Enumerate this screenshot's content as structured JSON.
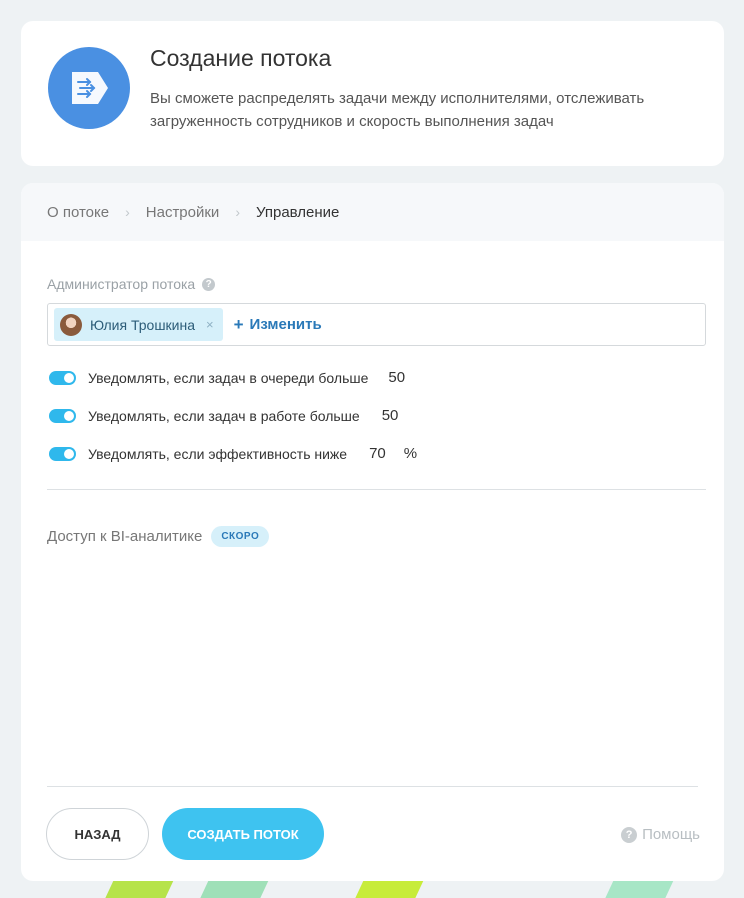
{
  "header": {
    "title": "Создание потока",
    "description": "Вы сможете распределять задачи между исполнителями, отслеживать загруженность сотрудников и скорость выполнения задач",
    "icon": "flow-icon"
  },
  "steps": [
    {
      "label": "О потоке"
    },
    {
      "label": "Настройки"
    },
    {
      "label": "Управление",
      "active": true
    }
  ],
  "admin": {
    "label": "Администратор потока",
    "user_name": "Юлия Трошкина",
    "remove_glyph": "×",
    "change_label": "Изменить",
    "change_plus": "+"
  },
  "notifications": [
    {
      "label": "Уведомлять, если задач в очереди больше",
      "value": "50",
      "unit": "",
      "enabled": true
    },
    {
      "label": "Уведомлять, если задач в работе больше",
      "value": "50",
      "unit": "",
      "enabled": true
    },
    {
      "label": "Уведомлять, если эффективность ниже",
      "value": "70",
      "unit": "%",
      "enabled": true
    }
  ],
  "bi": {
    "label": "Доступ к BI-аналитике",
    "badge": "СКОРО"
  },
  "footer": {
    "back_label": "НАЗАД",
    "create_label": "СОЗДАТЬ ПОТОК",
    "help_label": "Помощь"
  },
  "colors": {
    "accent": "#3ec3f0",
    "logo": "#4a90e2",
    "link": "#2a79b8"
  }
}
